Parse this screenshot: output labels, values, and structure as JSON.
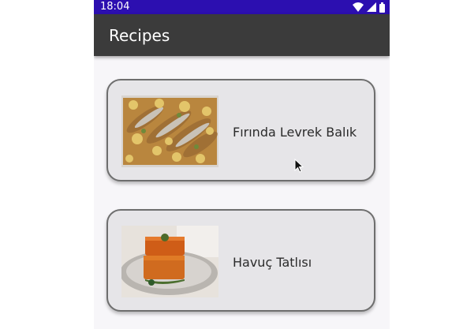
{
  "status_bar": {
    "time": "18:04",
    "icons": [
      "wifi-icon",
      "signal-icon",
      "battery-icon"
    ]
  },
  "app_bar": {
    "title": "Recipes"
  },
  "recipes": [
    {
      "title": "Fırında Levrek Balık",
      "image": "baked-sea-bass-photo"
    },
    {
      "title": "Havuç Tatlısı",
      "image": "carrot-dessert-photo"
    }
  ],
  "colors": {
    "status_bar": "#2c0fb0",
    "app_bar": "#3b3b3b",
    "card_background": "#e6e5e8",
    "card_border": "#6e6e6e"
  }
}
